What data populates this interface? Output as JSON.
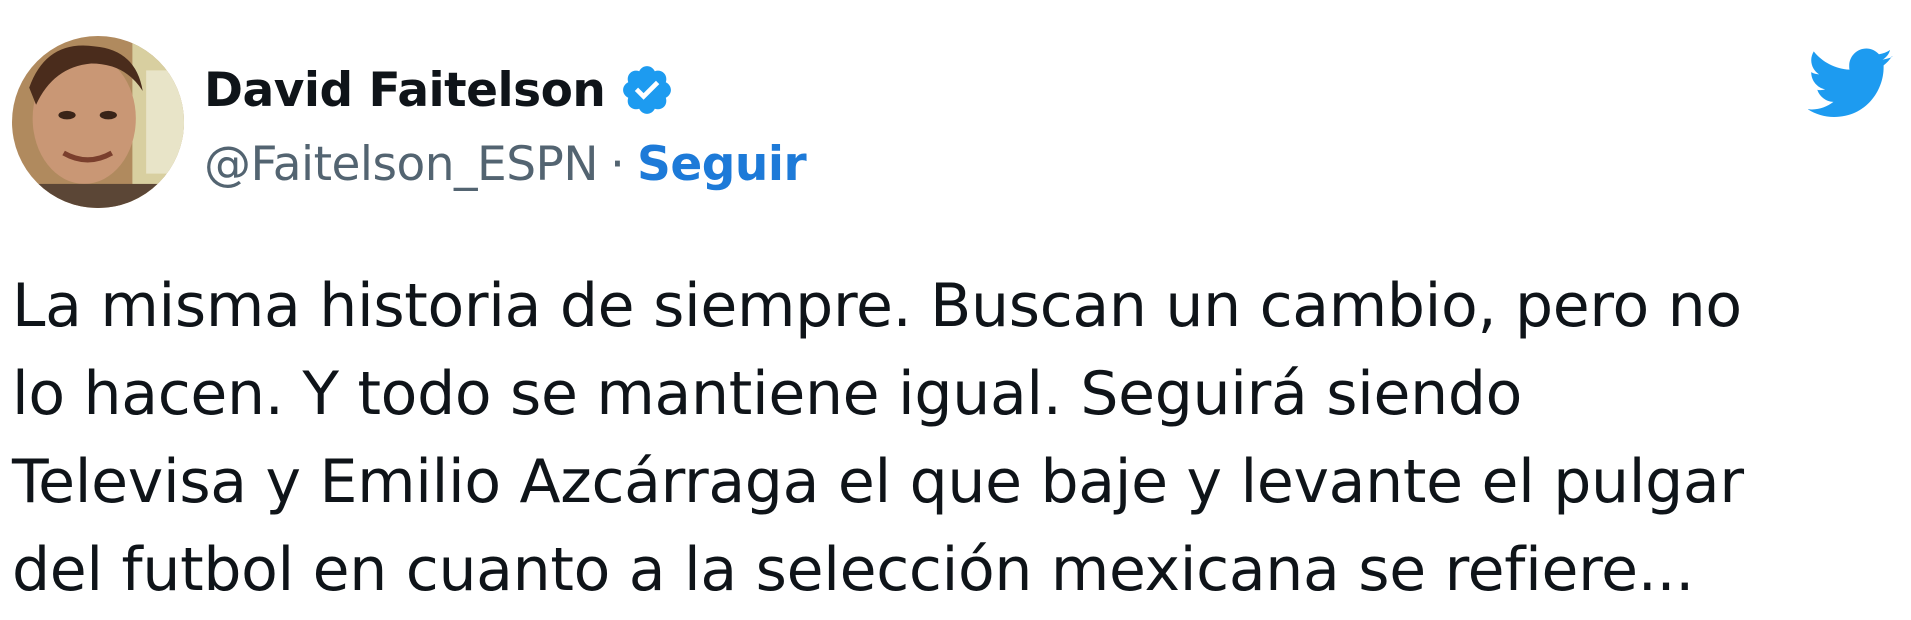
{
  "tweet": {
    "author": {
      "display_name": "David Faitelson",
      "handle": "@Faitelson_ESPN",
      "verified": true,
      "avatar_icon": "profile-photo"
    },
    "separator": "·",
    "follow_label": "Seguir",
    "platform_icon": "twitter-bird-icon",
    "text_lines": [
      "La misma historia de siempre. Buscan un cambio, pero no",
      "lo hacen. Y todo se mantiene igual. Seguirá siendo",
      "Televisa y Emilio Azcárraga el que baje y levante el pulgar",
      "del futbol en cuanto a la selección mexicana se refiere..."
    ]
  },
  "colors": {
    "brand_blue": "#1d9bf0",
    "follow_blue": "#1d7ad8",
    "text_primary": "#0f1419",
    "text_secondary": "#536471",
    "background": "#ffffff"
  }
}
